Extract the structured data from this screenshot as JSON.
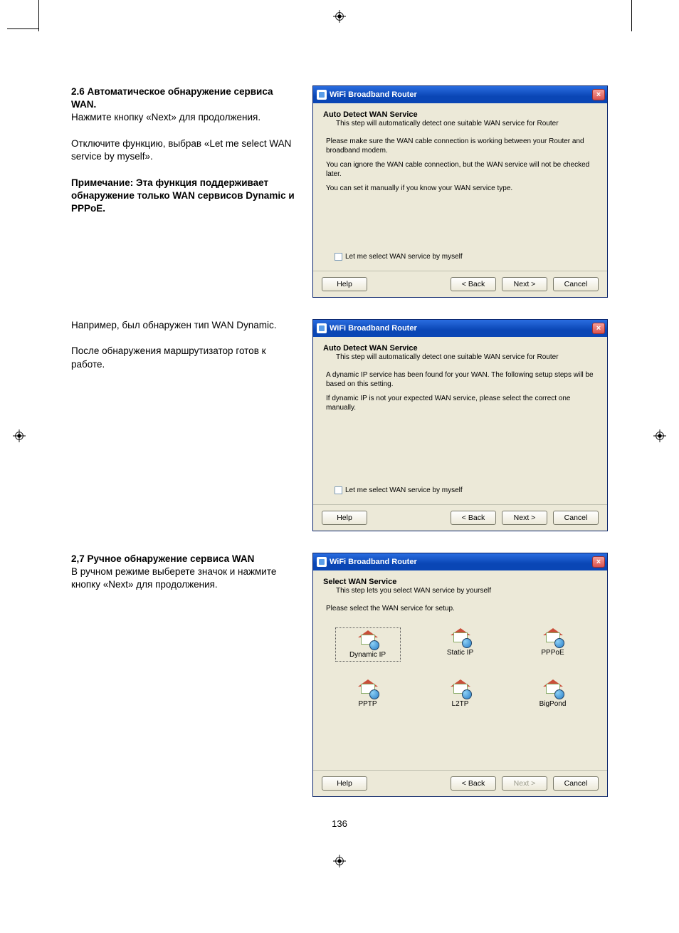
{
  "page_number": "136",
  "sections": {
    "s26": {
      "heading": "2.6 Автоматическое обнаружение сервиса WAN.",
      "p1": "Нажмите кнопку «Next» для продолжения.",
      "p2": "Отключите функцию, выбрав «Let me select WAN service by myself».",
      "note": "Примечание: Эта функция поддерживает обнаружение только WAN сервисов Dynamic и PPPoE.",
      "example_p1": "Например, был обнаружен тип WAN Dynamic.",
      "example_p2": "После обнаружения маршрутизатор готов к работе."
    },
    "s27": {
      "heading": "2,7 Ручное обнаружение сервиса WAN",
      "p1": "В ручном режиме выберете значок и нажмите кнопку «Next» для продолжения."
    }
  },
  "dialog_common": {
    "title": "WiFi Broadband Router",
    "close": "×",
    "help": "Help",
    "back": "< Back",
    "next": "Next >",
    "cancel": "Cancel",
    "checkbox_label": "Let me select WAN service by myself"
  },
  "dialog1": {
    "head": "Auto Detect WAN Service",
    "sub": "This step will automatically detect one suitable WAN service for Router",
    "para1": "Please make sure the WAN cable connection is working between your Router and broadband modem.",
    "para2": "You can ignore the WAN cable connection, but the WAN service will not be checked later.",
    "para3": "You can set it manually if you know your WAN service type."
  },
  "dialog2": {
    "head": "Auto Detect WAN Service",
    "sub": "This step will automatically detect one suitable WAN service for Router",
    "para1": "A dynamic IP service has been found for your WAN. The following setup steps will be based on this setting.",
    "para2": "If dynamic IP is not your expected WAN service, please select the correct one manually."
  },
  "dialog3": {
    "head": "Select WAN Service",
    "sub": "This step lets you select WAN service by yourself",
    "para1": "Please select the WAN service for setup.",
    "options": [
      "Dynamic IP",
      "Static IP",
      "PPPoE",
      "PPTP",
      "L2TP",
      "BigPond"
    ]
  }
}
